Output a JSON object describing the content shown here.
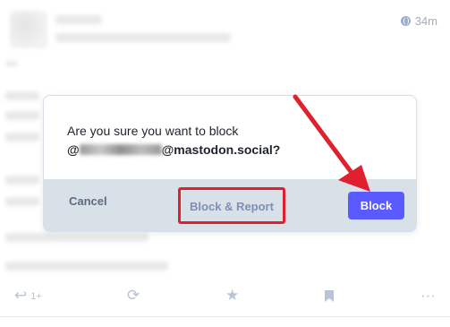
{
  "status": {
    "timestamp": "34m",
    "icons": {
      "visibility": "globe-icon",
      "reply": "reply-icon",
      "boost": "boost-icon",
      "favourite": "star-icon",
      "bookmark": "bookmark-icon",
      "more": "ellipsis-icon"
    },
    "reply_count": "1+"
  },
  "dialog": {
    "question": "Are you sure you want to block",
    "handle_prefix": "@",
    "handle_domain": "@mastodon.social?",
    "cancel_label": "Cancel",
    "block_report_label": "Block & Report",
    "block_label": "Block"
  },
  "colors": {
    "accent": "#595aff",
    "footer": "#d9e1e8",
    "annotation": "#e0202e",
    "muted": "#9baec8"
  }
}
